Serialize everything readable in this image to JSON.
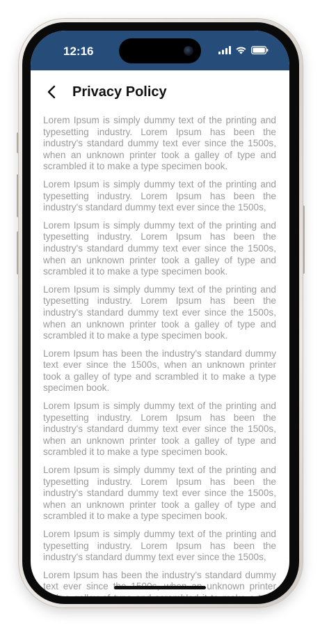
{
  "status_bar": {
    "time": "12:16",
    "background_color": "#264d7a",
    "icons": [
      "signal-icon",
      "wifi-icon",
      "battery-icon"
    ]
  },
  "header": {
    "title": "Privacy Policy",
    "back_icon": "chevron-left-icon"
  },
  "content": {
    "paragraphs": [
      "Lorem Ipsum is simply dummy text of the printing and typesetting industry. Lorem Ipsum has been the industry's standard dummy text ever since the 1500s, when an unknown printer took a galley of type and scrambled it to make a type specimen book.",
      "Lorem Ipsum is simply dummy text of the printing and typesetting industry. Lorem Ipsum has been the industry's standard dummy text ever since the 1500s,",
      "Lorem Ipsum is simply dummy text of the printing and typesetting industry. Lorem Ipsum has been the industry's standard dummy text ever since the 1500s, when an unknown printer took a galley of type and scrambled it to make a type specimen book.",
      "Lorem Ipsum is simply dummy text of the printing and typesetting industry. Lorem Ipsum has been the industry's standard dummy text ever since the 1500s, when an unknown printer took a galley of type and scrambled it to make a type specimen book.",
      "Lorem Ipsum has been the industry's standard dummy text ever since the 1500s, when an unknown printer took a galley of type and scrambled it to make a type specimen book.",
      "Lorem Ipsum is simply dummy text of the printing and typesetting industry. Lorem Ipsum has been the industry's standard dummy text ever since the 1500s, when an unknown printer took a galley of type and scrambled it to make a type specimen book.",
      "Lorem Ipsum is simply dummy text of the printing and typesetting industry. Lorem Ipsum has been the industry's standard dummy text ever since the 1500s, when an unknown printer took a galley of type and scrambled it to make a type specimen book.",
      "Lorem Ipsum is simply dummy text of the printing and typesetting industry. Lorem Ipsum has been the industry's standard dummy text ever since the 1500s,",
      "Lorem Ipsum has been the industry's standard dummy text ever since the 1500s, when an unknown printer took a galley of type and scrambled it to make a type specimen book."
    ],
    "text_color": "#9a9a9a"
  }
}
